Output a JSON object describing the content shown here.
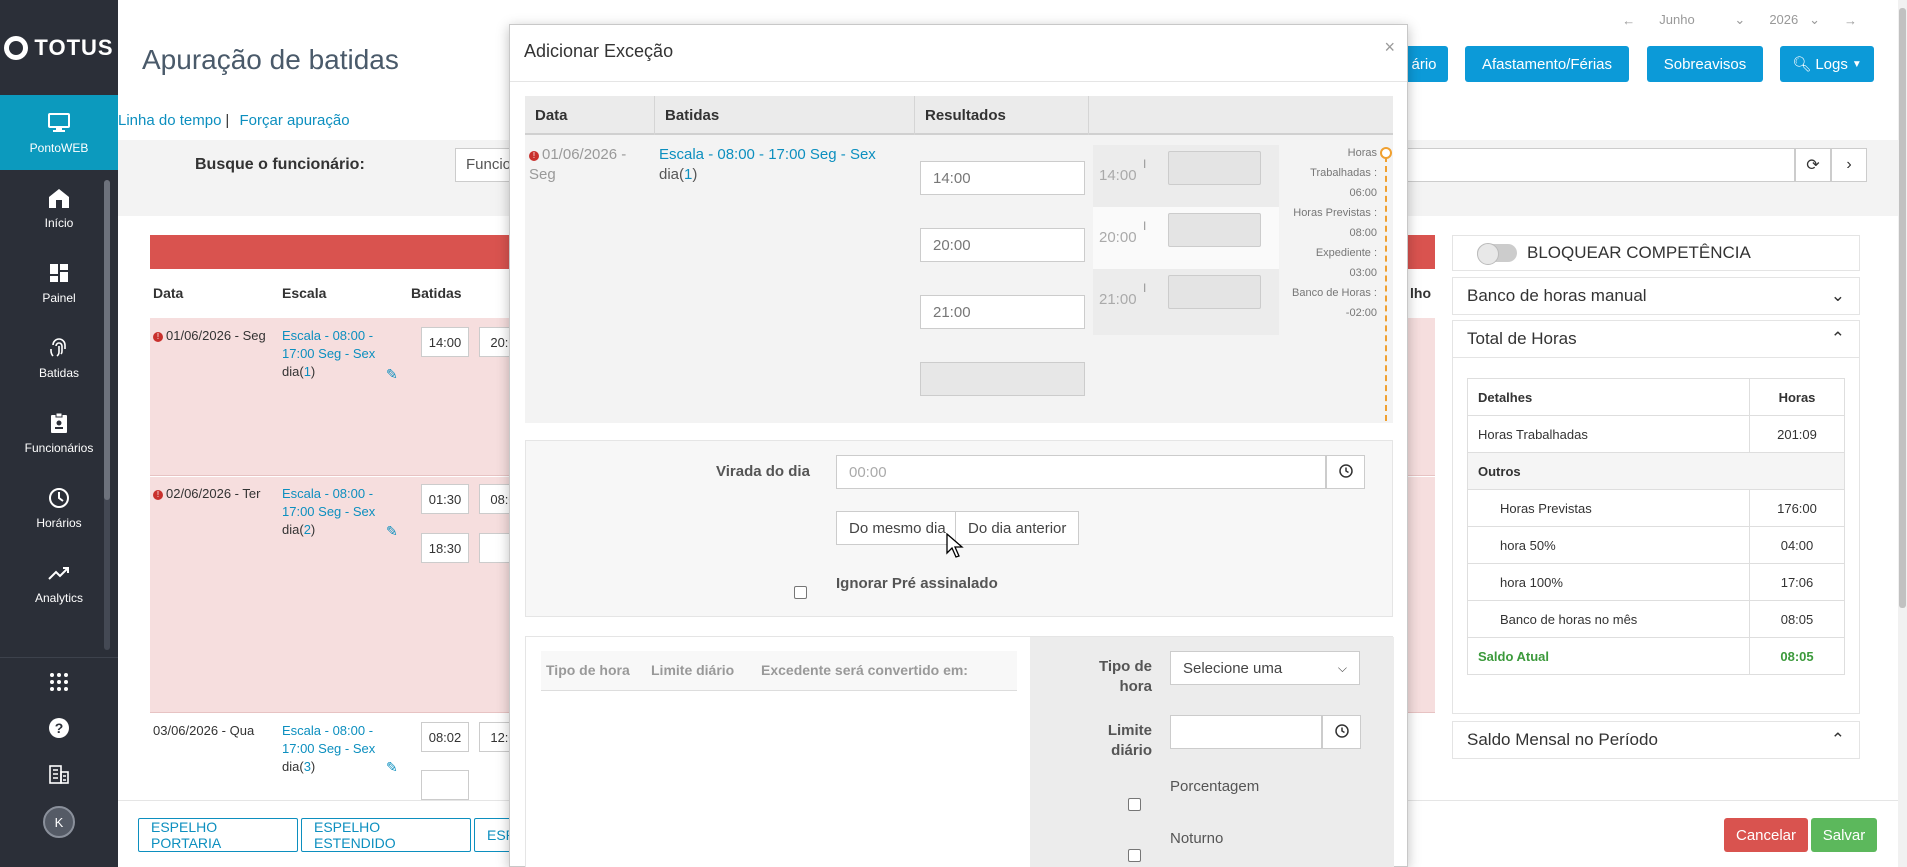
{
  "app": {
    "logo": "TOTUS",
    "page_title": "Apuração de batidas"
  },
  "sidebar": {
    "items": [
      {
        "label": "PontoWEB",
        "icon": "monitor-icon",
        "active": true
      },
      {
        "label": "Início",
        "icon": "home-icon"
      },
      {
        "label": "Painel",
        "icon": "dashboard-icon"
      },
      {
        "label": "Batidas",
        "icon": "fingerprint-icon"
      },
      {
        "label": "Funcionários",
        "icon": "badge-icon"
      },
      {
        "label": "Horários",
        "icon": "clock-icon"
      },
      {
        "label": "Analytics",
        "icon": "trend-icon"
      }
    ],
    "avatar": "K"
  },
  "links": {
    "timeline": "Linha do tempo",
    "separator": "|",
    "force": "Forçar apuração"
  },
  "top_nav": {
    "month": "Junho",
    "year": "2026"
  },
  "header_buttons": {
    "partial": "ário",
    "afastamento": "Afastamento/Férias",
    "sobreavisos": "Sobreavisos",
    "logs": "Logs"
  },
  "search": {
    "label": "Busque o funcionário:",
    "value": "Funcio"
  },
  "table": {
    "headers": {
      "date": "Data",
      "escala": "Escala",
      "batidas": "Batidas",
      "partial": "lho"
    },
    "rows": [
      {
        "date": "01/06/2026 - Seg",
        "escala_l1": "Escala - 08:00 -",
        "escala_l2": "17:00 Seg - Sex",
        "dia": "dia(",
        "dia_n": "1",
        "dia_close": ")",
        "b1": "14:00",
        "b2": "20:0"
      },
      {
        "date": "02/06/2026 - Ter",
        "escala_l1": "Escala - 08:00 -",
        "escala_l2": "17:00 Seg - Sex",
        "dia": "dia(",
        "dia_n": "2",
        "dia_close": ")",
        "b1": "01:30",
        "b2": "08:0",
        "b3": "18:30"
      },
      {
        "date": "03/06/2026 - Qua",
        "escala_l1": "Escala - 08:00 -",
        "escala_l2": "17:00 Seg - Sex",
        "dia": "dia(",
        "dia_n": "3",
        "dia_close": ")",
        "b1": "08:02",
        "b2": "12:0"
      }
    ]
  },
  "right_panel": {
    "bloquear": "BLOQUEAR COMPETÊNCIA",
    "banco_manual": "Banco de horas manual",
    "total_horas": "Total de Horas",
    "saldo_mensal": "Saldo Mensal no Período",
    "hours_table": {
      "col_detalhes": "Detalhes",
      "col_horas": "Horas",
      "trabalhadas_label": "Horas Trabalhadas",
      "trabalhadas_value": "201:09",
      "outros": "Outros",
      "previstas_label": "Horas Previstas",
      "previstas_value": "176:00",
      "h50_label": "hora 50%",
      "h50_value": "04:00",
      "h100_label": "hora 100%",
      "h100_value": "17:06",
      "banco_label": "Banco de horas no mês",
      "banco_value": "08:05",
      "saldo_label": "Saldo Atual",
      "saldo_value": "08:05"
    }
  },
  "bottom_buttons": {
    "espelho_portaria": "ESPELHO PORTARIA",
    "espelho_estendido": "ESPELHO ESTENDIDO",
    "partial": "ESP",
    "cancelar": "Cancelar",
    "salvar": "Salvar"
  },
  "modal": {
    "title": "Adicionar Exceção",
    "close": "×",
    "headers": {
      "data": "Data",
      "batidas": "Batidas",
      "resultados": "Resultados"
    },
    "date_l1": "01/06/2026 -",
    "date_l2": "Seg",
    "escala": "Escala - 08:00 - 17:00 Seg - Sex",
    "dia": "dia(",
    "dia_n": "1",
    "dia_close": ")",
    "inputs": [
      "14:00",
      "20:00",
      "21:00",
      ""
    ],
    "results": [
      {
        "time": "14:00"
      },
      {
        "time": "20:00"
      },
      {
        "time": "21:00"
      }
    ],
    "result_separator": "I",
    "summary": {
      "l1": "Horas",
      "l2": "Trabalhadas :",
      "l3": "06:00",
      "l4": "Horas Previstas :",
      "l5": "08:00",
      "l6": "Expediente :",
      "l7": "03:00",
      "l8": "Banco de Horas :",
      "l9": "-02:00"
    },
    "virada": {
      "label": "Virada do dia",
      "placeholder": "00:00",
      "same_day": "Do mesmo dia",
      "prev_day": "Do dia anterior",
      "ignorar": "Ignorar Pré assinalado"
    },
    "limits": {
      "col_tipo": "Tipo de hora",
      "col_limite": "Limite diário",
      "col_excedente": "Excedente será convertido em:",
      "tipo_label_l1": "Tipo de",
      "tipo_label_l2": "hora",
      "tipo_select": "Selecione uma",
      "limite_label_l1": "Limite",
      "limite_label_l2": "diário",
      "porcentagem": "Porcentagem",
      "noturno": "Noturno"
    }
  },
  "colors": {
    "accent": "#0c9ad8",
    "sidebar": "#2b2f38",
    "danger": "#d9534f",
    "success": "#5cb85c",
    "warning": "#f0a030"
  }
}
